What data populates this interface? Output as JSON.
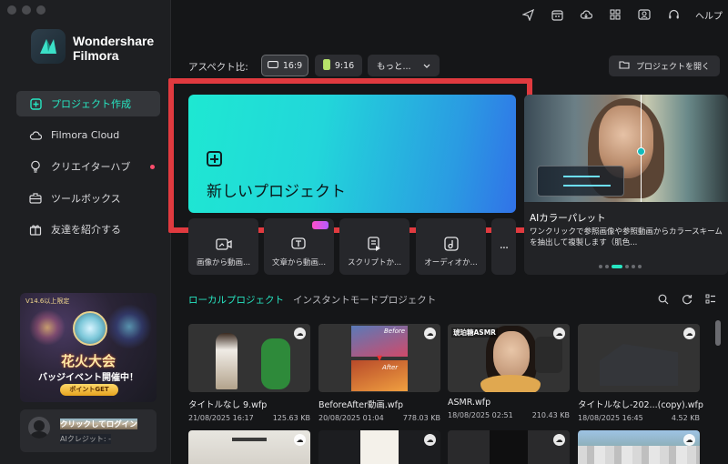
{
  "brand": {
    "line1": "Wondershare",
    "line2": "Filmora"
  },
  "sidebar": {
    "items": [
      {
        "label": "プロジェクト作成",
        "icon": "plus-square-icon",
        "active": true
      },
      {
        "label": "Filmora Cloud",
        "icon": "cloud-icon"
      },
      {
        "label": "クリエイターハブ",
        "icon": "bulb-icon",
        "notify": true
      },
      {
        "label": "ツールボックス",
        "icon": "toolbox-icon"
      },
      {
        "label": "友達を紹介する",
        "icon": "gift-icon"
      }
    ]
  },
  "banner": {
    "version": "V14.6以上限定",
    "title": "花火大会",
    "subtitle": "バッジイベント開催中！",
    "button": "ポイントGET"
  },
  "login": {
    "title": "クリックしてログイン",
    "credit": "AIクレジット: -"
  },
  "topbar": {
    "icons": [
      "send-icon",
      "calendar-icon",
      "cloud-download-icon",
      "grid-icon",
      "user-icon",
      "headset-icon"
    ],
    "help": "ヘルプ"
  },
  "aspect": {
    "label": "アスペクト比:",
    "ratio_169": "16:9",
    "ratio_916": "9:16",
    "more": "もっと..."
  },
  "open_project": "プロジェクトを開く",
  "new_project": "新しいプロジェクト",
  "quick_actions": [
    {
      "label": "画像から動画...",
      "icon": "image-to-video-icon"
    },
    {
      "label": "文章から動画...",
      "icon": "text-to-video-icon"
    },
    {
      "label": "スクリプトか...",
      "icon": "script-icon"
    },
    {
      "label": "オーディオか...",
      "icon": "audio-icon"
    },
    {
      "label": "...",
      "icon": "more-icon"
    }
  ],
  "promo": {
    "title": "AIカラーパレット",
    "desc": "ワンクリックで参照画像や参照動画からカラースキームを抽出して複製します（肌色..."
  },
  "tabs": {
    "local": "ローカルプロジェクト",
    "instant": "インスタントモードプロジェクト"
  },
  "projects": [
    {
      "name": "タイトルなし 9.wfp",
      "date": "21/08/2025 16:17",
      "size": "125.63 KB"
    },
    {
      "name": "BeforeAfter動画.wfp",
      "date": "20/08/2025 01:04",
      "size": "778.03 KB",
      "before": "Before",
      "after": "After"
    },
    {
      "name": "ASMR.wfp",
      "date": "18/08/2025 02:51",
      "size": "210.43 KB",
      "caption": "琥珀糖ASMR"
    },
    {
      "name": "タイトルなし-202...(copy).wfp",
      "date": "18/08/2025 16:45",
      "size": "4.52 KB"
    }
  ],
  "colors": {
    "accent": "#27e6c2",
    "highlight": "#e03a3f"
  }
}
